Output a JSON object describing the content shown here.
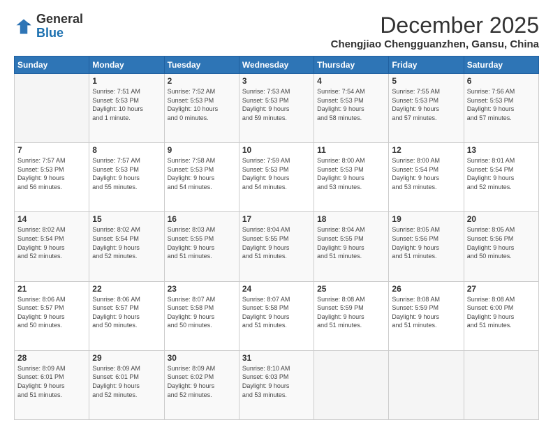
{
  "logo": {
    "general": "General",
    "blue": "Blue"
  },
  "header": {
    "month": "December 2025",
    "location": "Chengjiao Chengguanzhen, Gansu, China"
  },
  "weekdays": [
    "Sunday",
    "Monday",
    "Tuesday",
    "Wednesday",
    "Thursday",
    "Friday",
    "Saturday"
  ],
  "weeks": [
    [
      {
        "day": "",
        "info": ""
      },
      {
        "day": "1",
        "info": "Sunrise: 7:51 AM\nSunset: 5:53 PM\nDaylight: 10 hours\nand 1 minute."
      },
      {
        "day": "2",
        "info": "Sunrise: 7:52 AM\nSunset: 5:53 PM\nDaylight: 10 hours\nand 0 minutes."
      },
      {
        "day": "3",
        "info": "Sunrise: 7:53 AM\nSunset: 5:53 PM\nDaylight: 9 hours\nand 59 minutes."
      },
      {
        "day": "4",
        "info": "Sunrise: 7:54 AM\nSunset: 5:53 PM\nDaylight: 9 hours\nand 58 minutes."
      },
      {
        "day": "5",
        "info": "Sunrise: 7:55 AM\nSunset: 5:53 PM\nDaylight: 9 hours\nand 57 minutes."
      },
      {
        "day": "6",
        "info": "Sunrise: 7:56 AM\nSunset: 5:53 PM\nDaylight: 9 hours\nand 57 minutes."
      }
    ],
    [
      {
        "day": "7",
        "info": "Sunrise: 7:57 AM\nSunset: 5:53 PM\nDaylight: 9 hours\nand 56 minutes."
      },
      {
        "day": "8",
        "info": "Sunrise: 7:57 AM\nSunset: 5:53 PM\nDaylight: 9 hours\nand 55 minutes."
      },
      {
        "day": "9",
        "info": "Sunrise: 7:58 AM\nSunset: 5:53 PM\nDaylight: 9 hours\nand 54 minutes."
      },
      {
        "day": "10",
        "info": "Sunrise: 7:59 AM\nSunset: 5:53 PM\nDaylight: 9 hours\nand 54 minutes."
      },
      {
        "day": "11",
        "info": "Sunrise: 8:00 AM\nSunset: 5:53 PM\nDaylight: 9 hours\nand 53 minutes."
      },
      {
        "day": "12",
        "info": "Sunrise: 8:00 AM\nSunset: 5:54 PM\nDaylight: 9 hours\nand 53 minutes."
      },
      {
        "day": "13",
        "info": "Sunrise: 8:01 AM\nSunset: 5:54 PM\nDaylight: 9 hours\nand 52 minutes."
      }
    ],
    [
      {
        "day": "14",
        "info": "Sunrise: 8:02 AM\nSunset: 5:54 PM\nDaylight: 9 hours\nand 52 minutes."
      },
      {
        "day": "15",
        "info": "Sunrise: 8:02 AM\nSunset: 5:54 PM\nDaylight: 9 hours\nand 52 minutes."
      },
      {
        "day": "16",
        "info": "Sunrise: 8:03 AM\nSunset: 5:55 PM\nDaylight: 9 hours\nand 51 minutes."
      },
      {
        "day": "17",
        "info": "Sunrise: 8:04 AM\nSunset: 5:55 PM\nDaylight: 9 hours\nand 51 minutes."
      },
      {
        "day": "18",
        "info": "Sunrise: 8:04 AM\nSunset: 5:55 PM\nDaylight: 9 hours\nand 51 minutes."
      },
      {
        "day": "19",
        "info": "Sunrise: 8:05 AM\nSunset: 5:56 PM\nDaylight: 9 hours\nand 51 minutes."
      },
      {
        "day": "20",
        "info": "Sunrise: 8:05 AM\nSunset: 5:56 PM\nDaylight: 9 hours\nand 50 minutes."
      }
    ],
    [
      {
        "day": "21",
        "info": "Sunrise: 8:06 AM\nSunset: 5:57 PM\nDaylight: 9 hours\nand 50 minutes."
      },
      {
        "day": "22",
        "info": "Sunrise: 8:06 AM\nSunset: 5:57 PM\nDaylight: 9 hours\nand 50 minutes."
      },
      {
        "day": "23",
        "info": "Sunrise: 8:07 AM\nSunset: 5:58 PM\nDaylight: 9 hours\nand 50 minutes."
      },
      {
        "day": "24",
        "info": "Sunrise: 8:07 AM\nSunset: 5:58 PM\nDaylight: 9 hours\nand 51 minutes."
      },
      {
        "day": "25",
        "info": "Sunrise: 8:08 AM\nSunset: 5:59 PM\nDaylight: 9 hours\nand 51 minutes."
      },
      {
        "day": "26",
        "info": "Sunrise: 8:08 AM\nSunset: 5:59 PM\nDaylight: 9 hours\nand 51 minutes."
      },
      {
        "day": "27",
        "info": "Sunrise: 8:08 AM\nSunset: 6:00 PM\nDaylight: 9 hours\nand 51 minutes."
      }
    ],
    [
      {
        "day": "28",
        "info": "Sunrise: 8:09 AM\nSunset: 6:01 PM\nDaylight: 9 hours\nand 51 minutes."
      },
      {
        "day": "29",
        "info": "Sunrise: 8:09 AM\nSunset: 6:01 PM\nDaylight: 9 hours\nand 52 minutes."
      },
      {
        "day": "30",
        "info": "Sunrise: 8:09 AM\nSunset: 6:02 PM\nDaylight: 9 hours\nand 52 minutes."
      },
      {
        "day": "31",
        "info": "Sunrise: 8:10 AM\nSunset: 6:03 PM\nDaylight: 9 hours\nand 53 minutes."
      },
      {
        "day": "",
        "info": ""
      },
      {
        "day": "",
        "info": ""
      },
      {
        "day": "",
        "info": ""
      }
    ]
  ]
}
